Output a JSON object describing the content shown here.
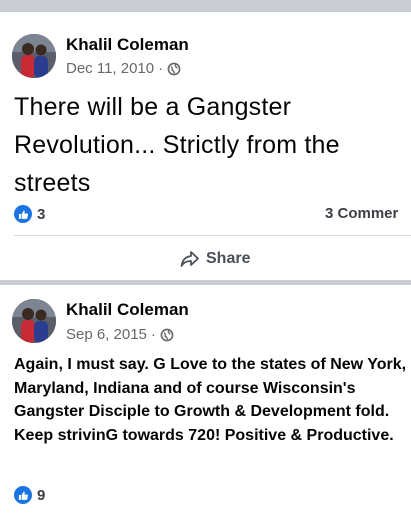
{
  "posts": [
    {
      "author": "Khalil Coleman",
      "date": "Dec 11, 2010",
      "separator": "·",
      "privacy_icon": "globe-icon",
      "text": "There will be a Gangster Revolution... Strictly from the streets",
      "reaction_icon": "like-icon",
      "reaction_count": "3",
      "comments": "3 Commer",
      "share_icon": "share-arrow-icon",
      "share_label": "Share"
    },
    {
      "author": "Khalil Coleman",
      "date": "Sep 6, 2015",
      "separator": "·",
      "privacy_icon": "globe-icon",
      "text": "Again, I must say. G Love to the states of New York, Maryland, Indiana and of course Wisconsin's Gangster Disciple to Growth & Development fold. Keep strivinG towards 720! Positive & Productive.",
      "reaction_icon": "like-icon",
      "reaction_count": "9"
    }
  ],
  "colors": {
    "background": "#c9ccd1",
    "card": "#ffffff",
    "secondary_text": "#65676b",
    "like_blue": "#1b74e4"
  }
}
